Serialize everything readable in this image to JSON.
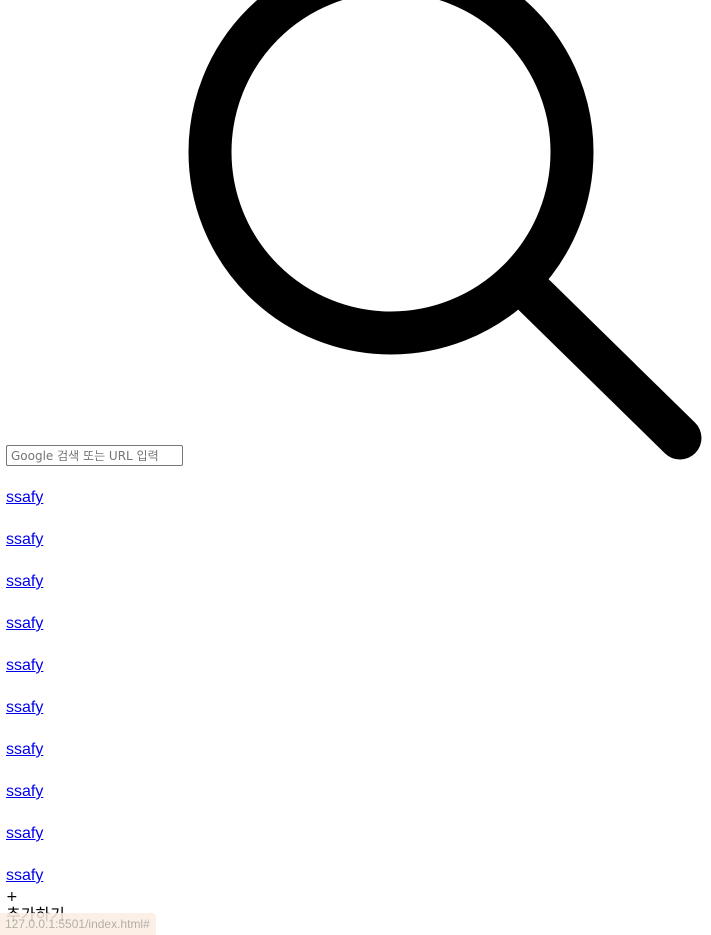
{
  "search": {
    "placeholder": "Google 검색 또는 URL 입력",
    "icon": "search-icon"
  },
  "shortcuts": [
    {
      "label": "ssafy"
    },
    {
      "label": "ssafy"
    },
    {
      "label": "ssafy"
    },
    {
      "label": "ssafy"
    },
    {
      "label": "ssafy"
    },
    {
      "label": "ssafy"
    },
    {
      "label": "ssafy"
    },
    {
      "label": "ssafy"
    },
    {
      "label": "ssafy"
    },
    {
      "label": "ssafy"
    }
  ],
  "add_shortcut": {
    "plus": "+",
    "label": "추가하기"
  },
  "status_bar": {
    "url": "127.0.0.1:5501/index.html#"
  },
  "colors": {
    "link": "#0000ee",
    "icon": "#000000",
    "status_bg": "#faece2"
  }
}
